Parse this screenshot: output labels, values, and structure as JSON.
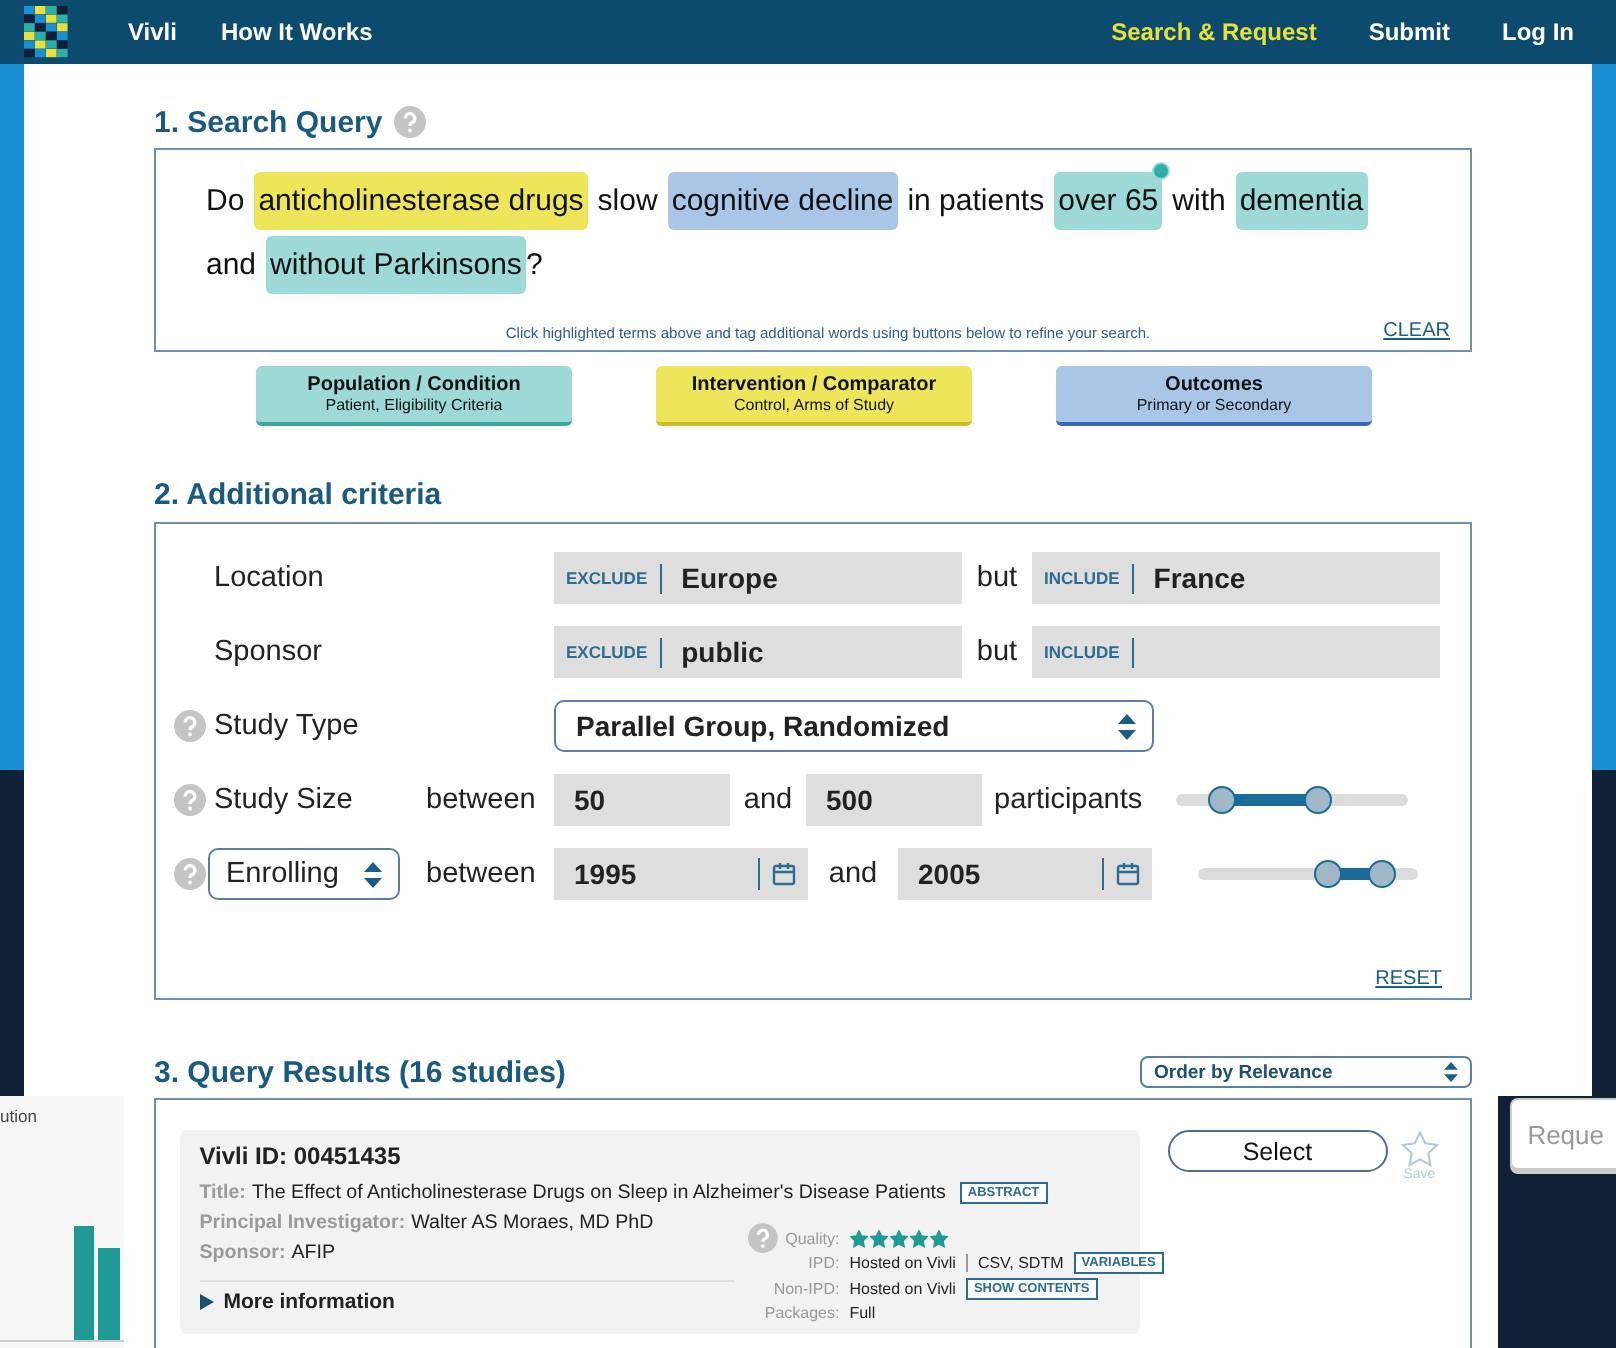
{
  "nav": {
    "brand": "Vivli",
    "links": [
      {
        "label": "How It Works",
        "selected": false
      }
    ],
    "right_links": [
      {
        "label": "Search & Request",
        "selected": true
      },
      {
        "label": "Submit",
        "selected": false
      },
      {
        "label": "Log In",
        "selected": false
      }
    ]
  },
  "query": {
    "title": "1. Search Query",
    "lines": [
      [
        {
          "text": "Do",
          "kind": "plain",
          "tag_dot": false
        },
        {
          "text": "anticholinesterase drugs",
          "kind": "intervention",
          "tag_dot": false
        },
        {
          "text": "slow",
          "kind": "plain",
          "tag_dot": false
        },
        {
          "text": "cognitive decline",
          "kind": "outcome",
          "tag_dot": false
        },
        {
          "text": "in patients",
          "kind": "plain",
          "tag_dot": false
        },
        {
          "text": "over 65",
          "kind": "population",
          "tag_dot": true
        },
        {
          "text": "with",
          "kind": "plain",
          "tag_dot": false
        },
        {
          "text": "dementia",
          "kind": "population",
          "tag_dot": false
        }
      ],
      [
        {
          "text": "and",
          "kind": "plain",
          "tag_dot": false
        },
        {
          "text": "without Parkinsons",
          "kind": "population",
          "tag_dot": false
        },
        {
          "text": "?",
          "kind": "punctuation",
          "tag_dot": false
        }
      ]
    ],
    "hint": "Click highlighted terms above and tag additional words using buttons below to refine your search.",
    "clear": "CLEAR",
    "tag_buttons": [
      {
        "title": "Population / Condition",
        "subtitle": "Patient, Eligibility Criteria",
        "kind": "population"
      },
      {
        "title": "Intervention / Comparator",
        "subtitle": "Control, Arms of Study",
        "kind": "intervention"
      },
      {
        "title": "Outcomes",
        "subtitle": "Primary or Secondary",
        "kind": "outcome"
      }
    ]
  },
  "criteria": {
    "title": "2. Additional criteria",
    "reset": "RESET",
    "rows": [
      {
        "kind": "exclude_include",
        "help": false,
        "label": "Location",
        "exclude_tag": "EXCLUDE",
        "exclude_value": "Europe",
        "joiner": "but",
        "include_tag": "INCLUDE",
        "include_value": "France"
      },
      {
        "kind": "exclude_include",
        "help": false,
        "label": "Sponsor",
        "exclude_tag": "EXCLUDE",
        "exclude_value": "public",
        "joiner": "but",
        "include_tag": "INCLUDE"
      },
      {
        "kind": "select",
        "help": true,
        "label": "Study Type",
        "value": "Parallel Group, Randomized"
      },
      {
        "kind": "range_number",
        "help": true,
        "label": "Study Size",
        "between": "between",
        "from": "50",
        "and": "and",
        "to": "500",
        "unit": "participants",
        "slider": {
          "low": {
            "level": 0.2
          },
          "high": {
            "level": 0.61
          }
        }
      },
      {
        "kind": "range_date",
        "help": true,
        "label_select": "Enrolling",
        "between": "between",
        "from": "1995",
        "and": "and",
        "to": "2005",
        "slider": {
          "low": {
            "level": 0.59
          },
          "high": {
            "level": 0.84
          }
        }
      }
    ]
  },
  "results": {
    "title": "3. Query Results (16 studies)",
    "order": "Order by Relevance",
    "card": {
      "id_label": "Vivli ID: 00451435",
      "fields": [
        {
          "label": "Title:",
          "value": "The Effect of Anticholinesterase Drugs on Sleep in Alzheimer's Disease Patients",
          "badge": "ABSTRACT"
        },
        {
          "label": "Principal Investigator:",
          "value": "Walter AS Moraes, MD PhD"
        },
        {
          "label": "Sponsor:",
          "value": "AFIP"
        }
      ],
      "more": "More information",
      "quality_label": "Quality:",
      "stars": 5,
      "meta": [
        {
          "label": "IPD:",
          "value": "Hosted on Vivli",
          "extra": "CSV, SDTM",
          "badge": "VARIABLES"
        },
        {
          "label": "Non-IPD:",
          "value": "Hosted on Vivli",
          "badge": "SHOW CONTENTS"
        },
        {
          "label": "Packages:",
          "value": "Full"
        }
      ],
      "select": "Select",
      "save": "Save",
      "saved": false
    }
  },
  "side_panel": {
    "title": "ution"
  },
  "request_button": {
    "label": "Reque"
  }
}
